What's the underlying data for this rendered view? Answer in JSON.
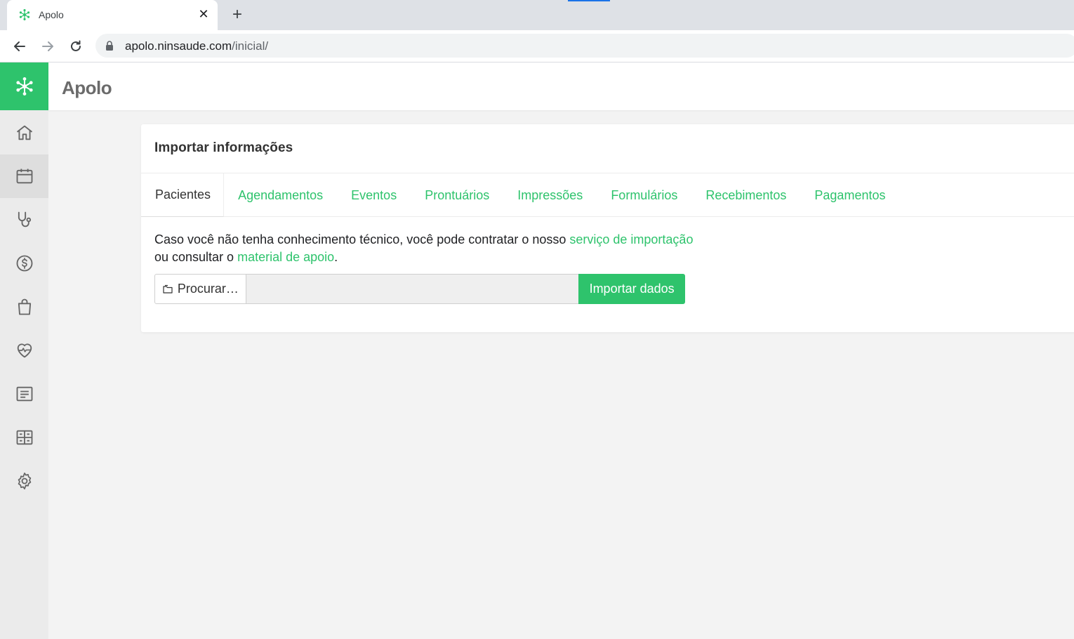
{
  "browser": {
    "tab_title": "Apolo",
    "url_host": "apolo.ninsaude.com",
    "url_path": "/inicial/"
  },
  "app": {
    "title": "Apolo",
    "brand_color": "#2ec36c"
  },
  "sidebar": {
    "items": [
      {
        "icon": "home-icon"
      },
      {
        "icon": "calendar-icon",
        "active": true
      },
      {
        "icon": "stethoscope-icon"
      },
      {
        "icon": "dollar-icon"
      },
      {
        "icon": "shopping-bag-icon"
      },
      {
        "icon": "heart-pulse-icon"
      },
      {
        "icon": "document-list-icon"
      },
      {
        "icon": "dashboard-grid-icon"
      },
      {
        "icon": "gear-icon"
      }
    ]
  },
  "card": {
    "title": "Importar informações",
    "tabs": [
      {
        "label": "Pacientes",
        "active": true
      },
      {
        "label": "Agendamentos"
      },
      {
        "label": "Eventos"
      },
      {
        "label": "Prontuários"
      },
      {
        "label": "Impressões"
      },
      {
        "label": "Formulários"
      },
      {
        "label": "Recebimentos"
      },
      {
        "label": "Pagamentos"
      }
    ],
    "info": {
      "part1": "Caso você não tenha conhecimento técnico, você pode contratar o nosso ",
      "link1": "serviço de importação",
      "part2": "ou consultar o ",
      "link2": "material de apoio",
      "part3": "."
    },
    "upload": {
      "browse_label": "Procurar…",
      "file_value": "",
      "import_label": "Importar dados"
    }
  }
}
